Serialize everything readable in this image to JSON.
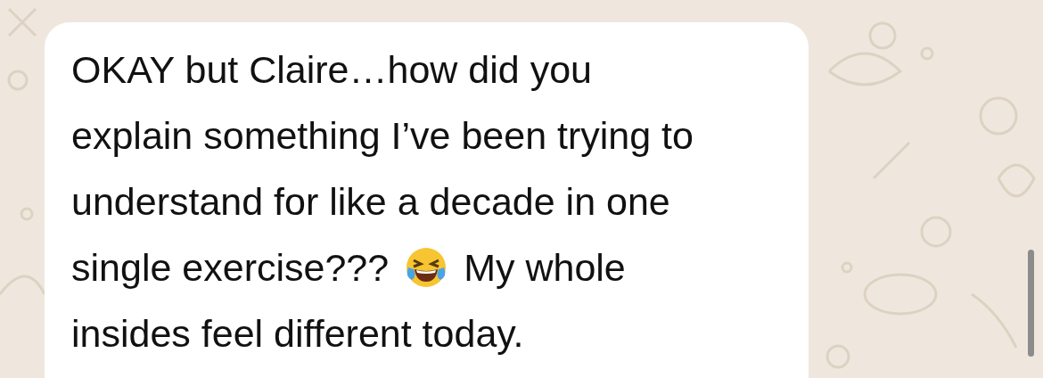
{
  "message": {
    "lines": [
      {
        "kind": "text",
        "text": "OKAY but Claire…how did you"
      },
      {
        "kind": "text",
        "text": "explain something I’ve been trying to"
      },
      {
        "kind": "text",
        "text": "understand for like a decade in one"
      },
      {
        "kind": "emoji",
        "text": "single exercise???",
        "text_after": "My whole"
      },
      {
        "kind": "text",
        "text": "insides feel different today."
      }
    ]
  }
}
